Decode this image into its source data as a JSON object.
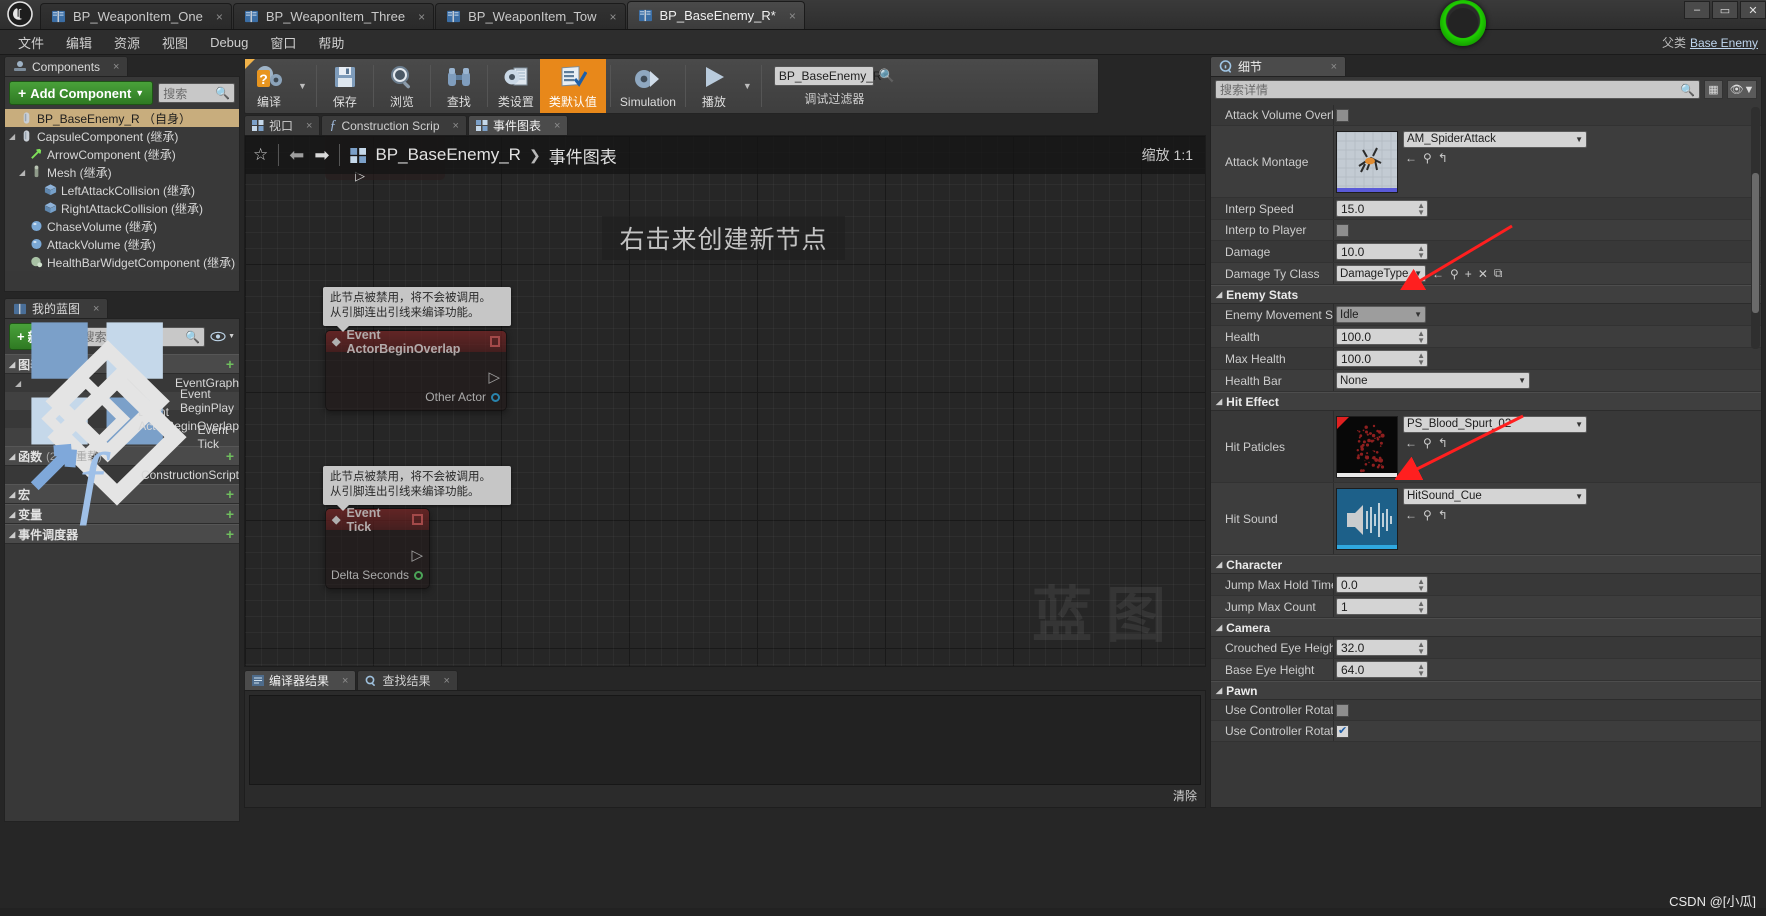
{
  "window": {
    "tabs": [
      {
        "label": "BP_WeaponItem_One",
        "active": false,
        "close": "×"
      },
      {
        "label": "BP_WeaponItem_Three",
        "active": false,
        "close": "×"
      },
      {
        "label": "BP_WeaponItem_Tow",
        "active": false,
        "close": "×"
      },
      {
        "label": "BP_BaseEnemy_R*",
        "active": true,
        "close": "×"
      }
    ],
    "controls": {
      "minimize": "–",
      "maximize": "▭",
      "close": "✕"
    }
  },
  "menu": {
    "items": [
      "文件",
      "编辑",
      "资源",
      "视图",
      "Debug",
      "窗口",
      "帮助"
    ]
  },
  "parent_class": {
    "label": "父类",
    "value": "Base Enemy"
  },
  "toolbar": {
    "compile": "编译",
    "save": "保存",
    "browse": "浏览",
    "find": "查找",
    "class_settings": "类设置",
    "class_defaults": "类默认值",
    "simulation": "Simulation",
    "play": "播放",
    "debug_filter_value": "BP_BaseEnemy_R",
    "debug_filter_label": "调试过滤器"
  },
  "components_panel": {
    "tab_title": "Components",
    "tab_close": "×",
    "add_button": "Add Component",
    "add_button_plus": "+",
    "search_placeholder": "搜索",
    "tree": [
      {
        "label": "BP_BaseEnemy_R （自身）",
        "depth": 0,
        "selected": true,
        "arrow": "",
        "icon": "capsule-icon"
      },
      {
        "label": "CapsuleComponent (继承)",
        "depth": 0,
        "selected": false,
        "arrow": "◢",
        "icon": "capsule-icon"
      },
      {
        "label": "ArrowComponent (继承)",
        "depth": 1,
        "selected": false,
        "arrow": "",
        "icon": "arrow-icon"
      },
      {
        "label": "Mesh (继承)",
        "depth": 1,
        "selected": false,
        "arrow": "◢",
        "icon": "mesh-icon"
      },
      {
        "label": "LeftAttackCollision (继承)",
        "depth": 2,
        "selected": false,
        "arrow": "",
        "icon": "box-icon"
      },
      {
        "label": "RightAttackCollision (继承)",
        "depth": 2,
        "selected": false,
        "arrow": "",
        "icon": "box-icon"
      },
      {
        "label": "ChaseVolume (继承)",
        "depth": 1,
        "selected": false,
        "arrow": "",
        "icon": "sphere-icon"
      },
      {
        "label": "AttackVolume (继承)",
        "depth": 1,
        "selected": false,
        "arrow": "",
        "icon": "sphere-icon"
      },
      {
        "label": "HealthBarWidgetComponent (继承)",
        "depth": 1,
        "selected": false,
        "arrow": "",
        "icon": "widget-icon"
      }
    ]
  },
  "myblueprint_panel": {
    "tab_title": "我的蓝图",
    "tab_close": "×",
    "new_button": "新增",
    "new_button_plus": "+",
    "search_placeholder": "搜索",
    "sections": [
      {
        "title": "图表",
        "count": "",
        "add": "+",
        "items": [
          {
            "label": "EventGraph",
            "depth": 0,
            "icon": "graph-icon",
            "arrow": "◢"
          },
          {
            "label": "Event BeginPlay",
            "depth": 1,
            "icon": "event-icon",
            "arrow": ""
          },
          {
            "label": "Event ActorBeginOverlap",
            "depth": 1,
            "icon": "event-icon",
            "arrow": ""
          },
          {
            "label": "Event Tick",
            "depth": 1,
            "icon": "event-icon",
            "arrow": ""
          }
        ]
      },
      {
        "title": "函数",
        "count": "(29 可重载)",
        "add": "+",
        "items": [
          {
            "label": "ConstructionScript",
            "depth": 0,
            "icon": "function-icon",
            "arrow": ""
          }
        ]
      },
      {
        "title": "宏",
        "count": "",
        "add": "+",
        "items": []
      },
      {
        "title": "变量",
        "count": "",
        "add": "+",
        "items": []
      },
      {
        "title": "事件调度器",
        "count": "",
        "add": "+",
        "items": []
      }
    ]
  },
  "graph": {
    "tabs": [
      {
        "label": "视口",
        "active": false,
        "icon": "viewport-icon",
        "close": "×"
      },
      {
        "label": "Construction Scrip",
        "active": false,
        "icon": "function-icon",
        "close": "×"
      },
      {
        "label": "事件图表",
        "active": true,
        "icon": "graph-icon",
        "close": "×"
      }
    ],
    "breadcrumb_root": "BP_BaseEnemy_R",
    "breadcrumb_chev": "❯",
    "breadcrumb_leaf": "事件图表",
    "zoom_label": "缩放 1:1",
    "hint": "右击来创建新节点",
    "watermark": "蓝图",
    "nodes": [
      {
        "title": "Event ActorBeginOverlap",
        "tooltip_line1": "此节点被禁用，将不会被调用。",
        "tooltip_line2": "从引脚连出引线来编译功能。",
        "pin_label": "Other Actor"
      },
      {
        "title": "Event Tick",
        "tooltip_line1": "此节点被禁用，将不会被调用。",
        "tooltip_line2": "从引脚连出引线来编译功能。",
        "pin_label": "Delta Seconds"
      }
    ]
  },
  "bottom_panel": {
    "tabs": [
      {
        "label": "编译器结果",
        "active": true,
        "close": "×"
      },
      {
        "label": "查找结果",
        "active": false,
        "close": "×"
      }
    ],
    "clear_label": "清除"
  },
  "details_panel": {
    "tab_title": "细节",
    "tab_close": "×",
    "search_placeholder": "搜索详情",
    "categories": [
      {
        "name": "",
        "rows": [
          {
            "label": "Attack Volume Overlap",
            "type": "checkbox",
            "checked": false
          },
          {
            "label": "Attack Montage",
            "type": "asset",
            "value": "AM_SpiderAttack",
            "thumb": "anim-montage-thumb"
          },
          {
            "label": "Interp Speed",
            "type": "number",
            "value": "15.0"
          },
          {
            "label": "Interp to Player",
            "type": "checkbox",
            "checked": false
          },
          {
            "label": "Damage",
            "type": "number",
            "value": "10.0"
          },
          {
            "label": "Damage Ty Class",
            "type": "class",
            "value": "DamageType"
          }
        ]
      },
      {
        "name": "Enemy Stats",
        "rows": [
          {
            "label": "Enemy Movement Stat",
            "type": "enum",
            "value": "Idle"
          },
          {
            "label": "Health",
            "type": "number",
            "value": "100.0"
          },
          {
            "label": "Max Health",
            "type": "number",
            "value": "100.0"
          },
          {
            "label": "Health Bar",
            "type": "select",
            "value": "None"
          }
        ]
      },
      {
        "name": "Hit Effect",
        "rows": [
          {
            "label": "Hit Paticles",
            "type": "asset",
            "value": "PS_Blood_Spurt_02",
            "thumb": "particle-thumb"
          },
          {
            "label": "Hit Sound",
            "type": "asset",
            "value": "HitSound_Cue",
            "thumb": "sound-cue-thumb"
          }
        ]
      },
      {
        "name": "Character",
        "rows": [
          {
            "label": "Jump Max Hold Time",
            "type": "number",
            "value": "0.0"
          },
          {
            "label": "Jump Max Count",
            "type": "number",
            "value": "1"
          }
        ]
      },
      {
        "name": "Camera",
        "rows": [
          {
            "label": "Crouched Eye Height",
            "type": "number",
            "value": "32.0"
          },
          {
            "label": "Base Eye Height",
            "type": "number",
            "value": "64.0"
          }
        ]
      },
      {
        "name": "Pawn",
        "rows": [
          {
            "label": "Use Controller Rotation",
            "type": "checkbox",
            "checked": false
          },
          {
            "label": "Use Controller Rotation",
            "type": "checkbox",
            "checked": true
          }
        ]
      }
    ],
    "asset_buttons": {
      "back": "←",
      "browse": "⚲",
      "use": "↰",
      "clear": "✕",
      "plus": "+",
      "copy": "⧉"
    }
  },
  "watermark_csdn": "CSDN @[小瓜]",
  "colors": {
    "accent_orange": "#e8881a",
    "green_button": "#3f8f2f",
    "selection_tan": "#c8ad7d",
    "node_red": "#8c2a2a",
    "annotation_red": "#ff2020"
  }
}
